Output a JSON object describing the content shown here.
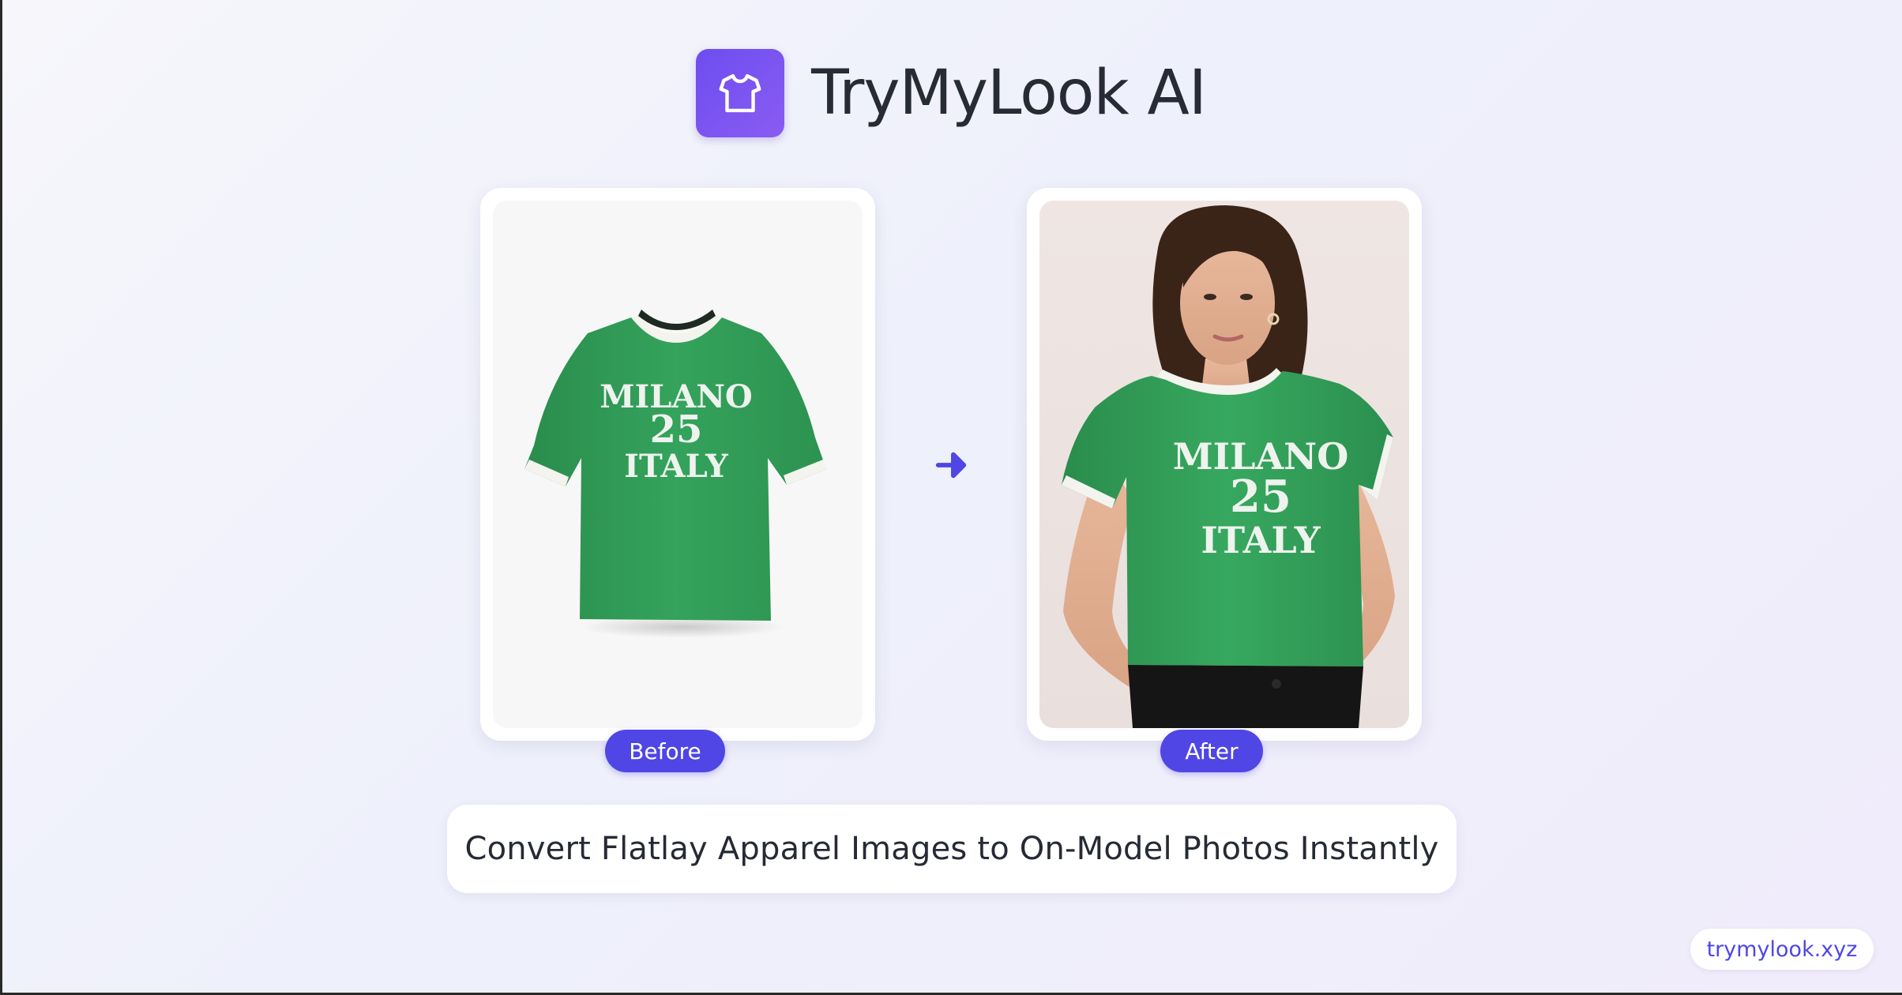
{
  "header": {
    "title": "TryMyLook AI",
    "logo_icon": "tshirt-icon"
  },
  "comparison": {
    "before": {
      "label": "Before",
      "image": "flatlay-tshirt-image",
      "shirt_text_top": "MILANO",
      "shirt_text_mid": "25",
      "shirt_text_bottom": "ITALY"
    },
    "arrow_icon": "arrow-right-icon",
    "after": {
      "label": "After",
      "image": "on-model-photo-image",
      "shirt_text_top": "MILANO",
      "shirt_text_mid": "25",
      "shirt_text_bottom": "ITALY"
    }
  },
  "tagline": "Convert Flatlay Apparel Images to On-Model Photos Instantly",
  "footer": {
    "site": "trymylook.xyz"
  },
  "colors": {
    "accent": "#4f46e5",
    "logo_gradient_start": "#6d4df0",
    "logo_gradient_end": "#8a5cf2",
    "shirt_green": "#2f9a55",
    "background": "#f2f2fb"
  }
}
